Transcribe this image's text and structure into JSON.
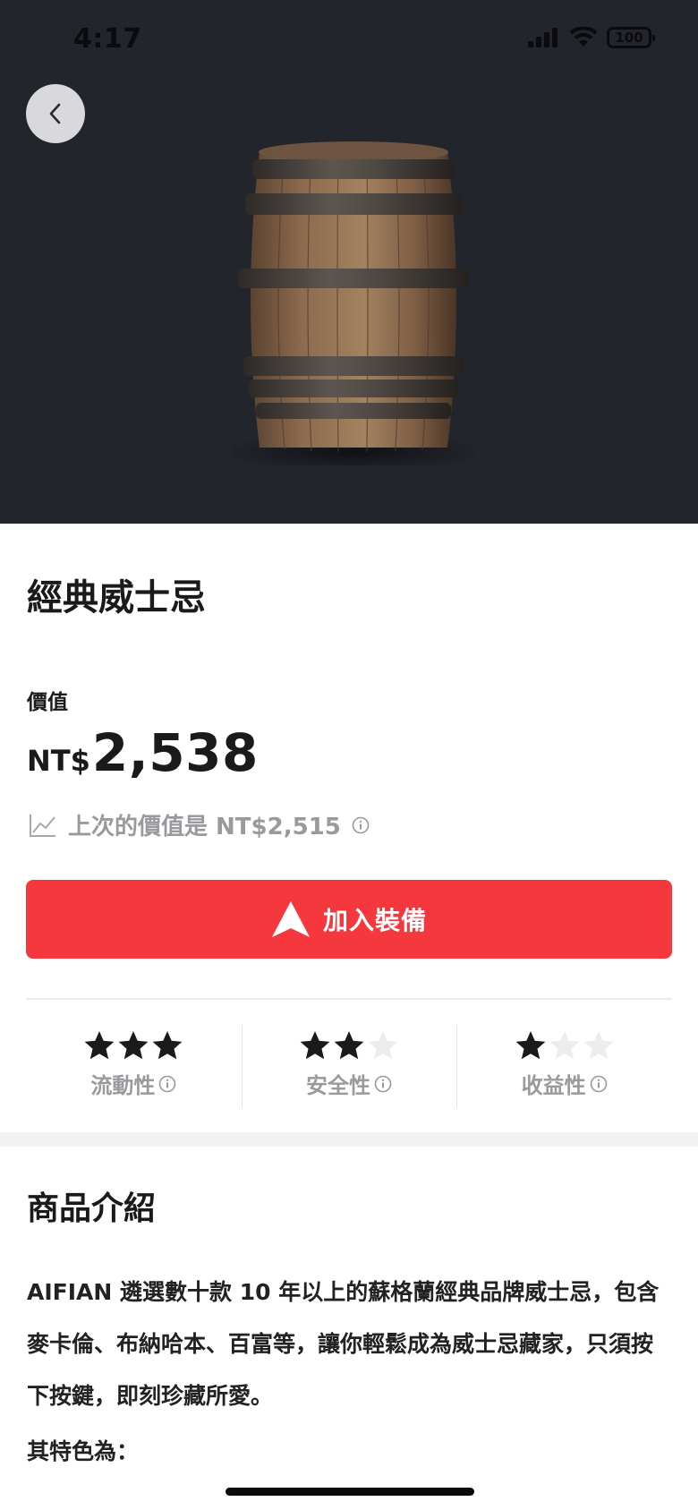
{
  "status_bar": {
    "time": "4:17",
    "battery": "100",
    "icons": [
      "signal-icon",
      "wifi-icon",
      "battery-icon"
    ]
  },
  "header": {
    "back_icon": "chevron-left-icon"
  },
  "product": {
    "image": "whisky-barrel",
    "title": "經典威士忌",
    "value_label": "價值",
    "price_currency": "NT$",
    "price_amount": "2,538",
    "previous_value_text": "上次的價值是 NT$2,515",
    "add_button_label": "加入裝備"
  },
  "ratings": [
    {
      "label": "流動性",
      "stars": 3,
      "max": 3
    },
    {
      "label": "安全性",
      "stars": 2,
      "max": 3
    },
    {
      "label": "收益性",
      "stars": 1,
      "max": 3
    }
  ],
  "intro": {
    "section_title": "商品介紹",
    "description": "AIFIAN 遴選數十款 10 年以上的蘇格蘭經典品牌威士忌，包含麥卡倫、布納哈本、百富等，讓你輕鬆成為威士忌藏家，只須按下按鍵，即刻珍藏所愛。",
    "features_heading": "其特色為："
  },
  "colors": {
    "hero_bg": "#23252c",
    "accent": "#f5383e",
    "muted_text": "#9a9a9e",
    "star_filled": "#1a1a1a",
    "star_empty": "#ededf0"
  }
}
